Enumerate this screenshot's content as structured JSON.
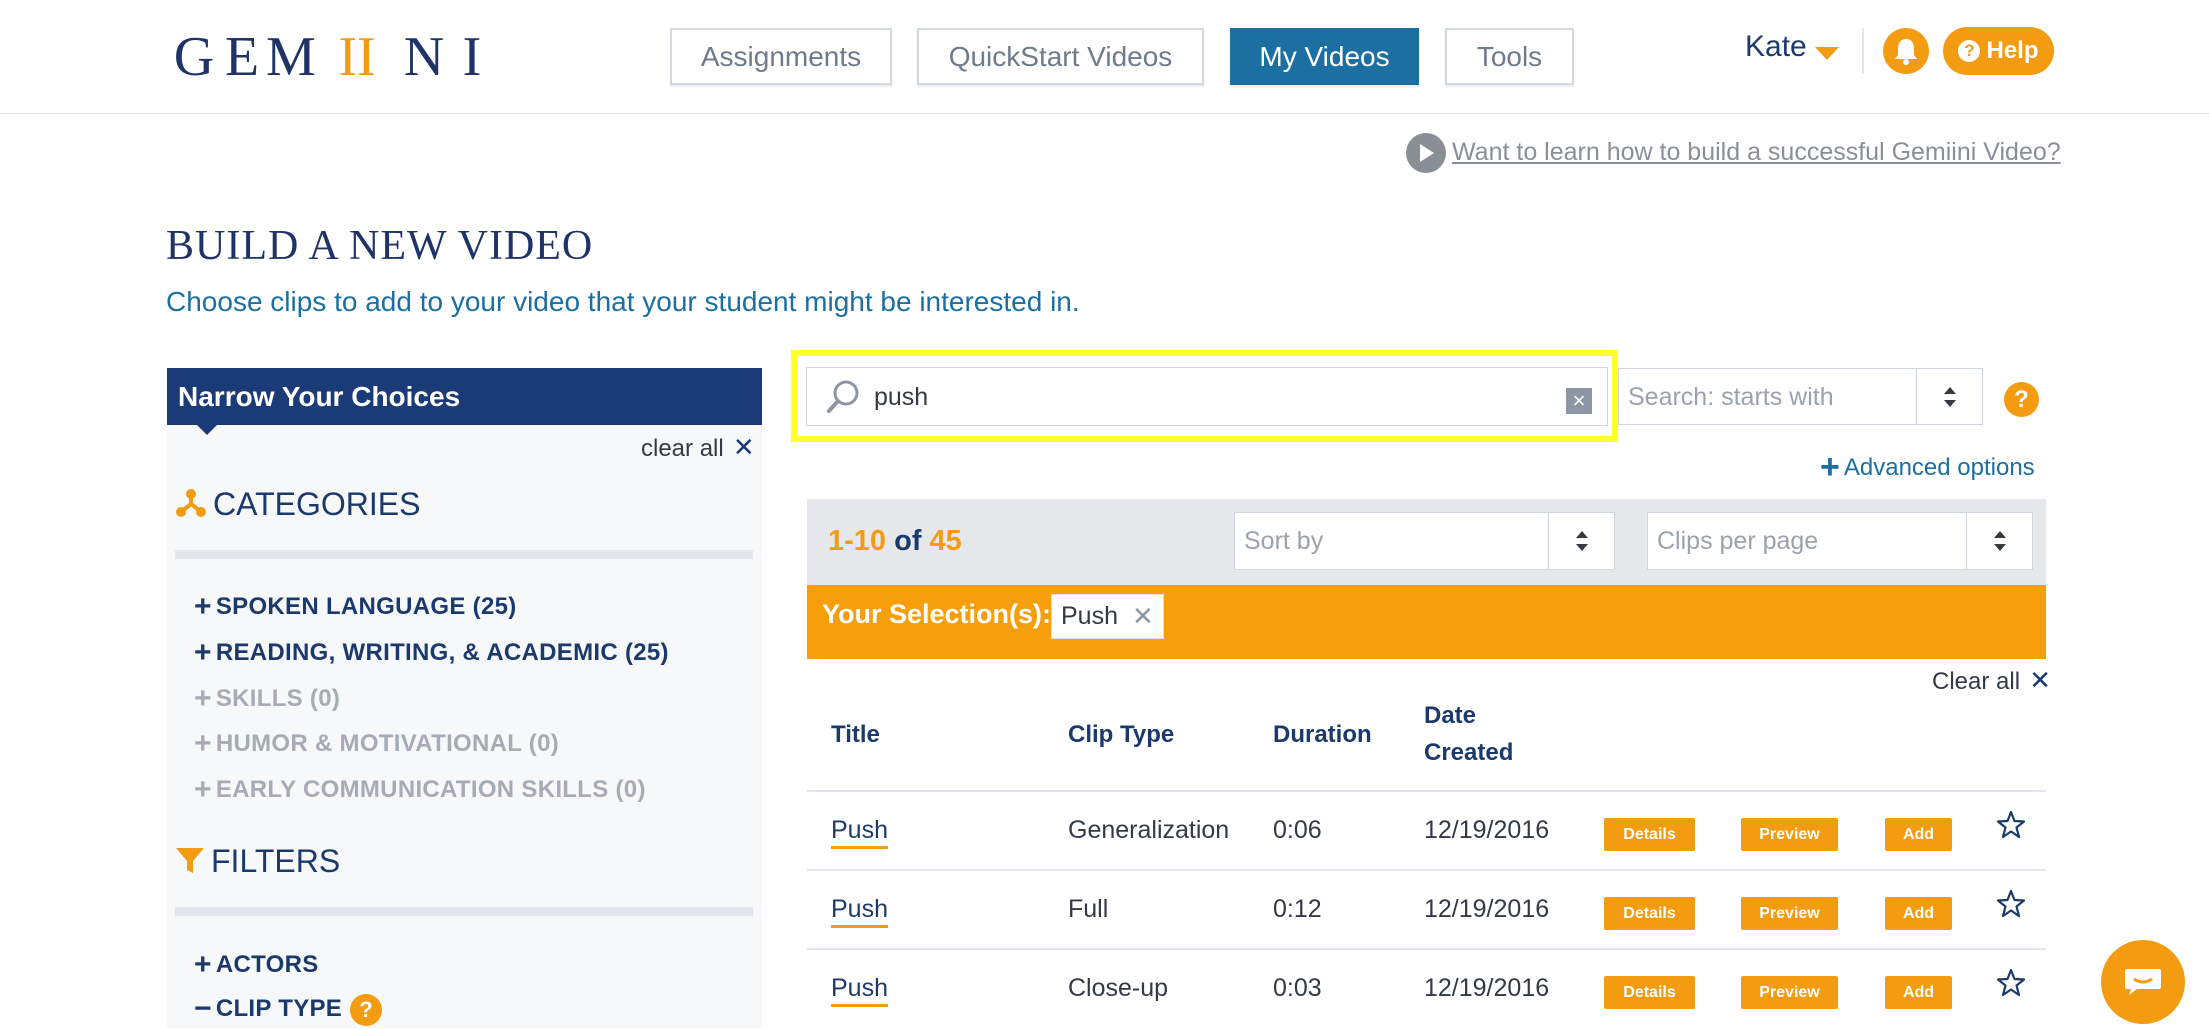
{
  "header": {
    "logo": "GEMIINI",
    "nav": [
      "Assignments",
      "QuickStart Videos",
      "My Videos",
      "Tools"
    ],
    "active_nav": "My Videos",
    "user": "Kate",
    "help": "Help"
  },
  "learn_link": "Want to learn how to build a successful Gemiini Video?",
  "page": {
    "title": "BUILD A NEW VIDEO",
    "subtitle": "Choose clips to add to your video that your student might be interested in."
  },
  "sidebar": {
    "header": "Narrow Your Choices",
    "clear_all": "clear all",
    "categories_title": "CATEGORIES",
    "categories": [
      {
        "label": "SPOKEN LANGUAGE (25)",
        "enabled": true
      },
      {
        "label": "READING, WRITING, & ACADEMIC (25)",
        "enabled": true
      },
      {
        "label": "SKILLS (0)",
        "enabled": false
      },
      {
        "label": "HUMOR & MOTIVATIONAL (0)",
        "enabled": false
      },
      {
        "label": "EARLY COMMUNICATION SKILLS (0)",
        "enabled": false
      }
    ],
    "filters_title": "FILTERS",
    "filters": [
      {
        "label": "ACTORS",
        "expanded": false
      },
      {
        "label": "CLIP TYPE",
        "expanded": true
      }
    ]
  },
  "search": {
    "value": "push",
    "mode_placeholder": "Search: starts with",
    "advanced": "Advanced options"
  },
  "results": {
    "range": "1-10",
    "of": "of",
    "total": "45",
    "sort_placeholder": "Sort by",
    "per_page_placeholder": "Clips per page",
    "selection_label": "Your Selection(s):",
    "selection_chip": "Push",
    "clear_all": "Clear all"
  },
  "table": {
    "headers": {
      "title": "Title",
      "clip_type": "Clip Type",
      "duration": "Duration",
      "date_line1": "Date",
      "date_line2": "Created"
    },
    "rows": [
      {
        "title": "Push",
        "clip_type": "Generalization",
        "duration": "0:06",
        "date": "12/19/2016"
      },
      {
        "title": "Push",
        "clip_type": "Full",
        "duration": "0:12",
        "date": "12/19/2016"
      },
      {
        "title": "Push",
        "clip_type": "Close-up",
        "duration": "0:03",
        "date": "12/19/2016"
      }
    ],
    "actions": {
      "details": "Details",
      "preview": "Preview",
      "add": "Add"
    }
  },
  "colors": {
    "accent": "#f39c12",
    "primary": "#1b3a78",
    "active_nav": "#1b6fa1",
    "highlight": "#ffff2b"
  }
}
